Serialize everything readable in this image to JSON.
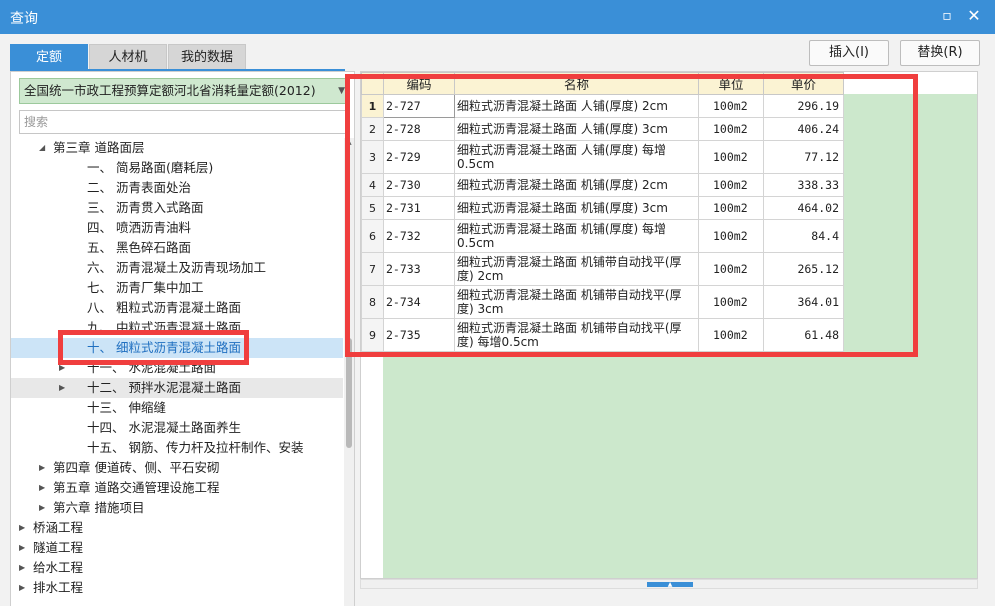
{
  "window": {
    "title": "查询",
    "maximize_glyph": "▫",
    "close_glyph": "✕"
  },
  "tabs": [
    {
      "label": "定额",
      "active": true
    },
    {
      "label": "人材机",
      "active": false
    },
    {
      "label": "我的数据",
      "active": false
    }
  ],
  "actions": {
    "insert_label": "插入(I)",
    "replace_label": "替换(R)"
  },
  "left": {
    "quota_library": "全国统一市政工程预算定额河北省消耗量定额(2012)",
    "search_placeholder": "搜索",
    "tree": [
      {
        "label": "第三章 道路面层",
        "toggle": "◢",
        "level": 1
      },
      {
        "label": "一、 简易路面(磨耗层)",
        "toggle": "",
        "level": 2
      },
      {
        "label": "二、 沥青表面处治",
        "toggle": "",
        "level": 2
      },
      {
        "label": "三、 沥青贯入式路面",
        "toggle": "",
        "level": 2
      },
      {
        "label": "四、 喷洒沥青油料",
        "toggle": "",
        "level": 2
      },
      {
        "label": "五、 黑色碎石路面",
        "toggle": "",
        "level": 2
      },
      {
        "label": "六、 沥青混凝土及沥青现场加工",
        "toggle": "",
        "level": 2
      },
      {
        "label": "七、 沥青厂集中加工",
        "toggle": "",
        "level": 2
      },
      {
        "label": "八、 粗粒式沥青混凝土路面",
        "toggle": "",
        "level": 2
      },
      {
        "label": "九、 中粒式沥青混凝土路面",
        "toggle": "",
        "level": 2
      },
      {
        "label": "十、 细粒式沥青混凝土路面",
        "toggle": "",
        "level": 2,
        "state": "selected"
      },
      {
        "label": "十一、 水泥混凝土路面",
        "toggle": "▶",
        "level": 2
      },
      {
        "label": "十二、 预拌水泥混凝土路面",
        "toggle": "▶",
        "level": 2,
        "state": "hover"
      },
      {
        "label": "十三、 伸缩缝",
        "toggle": "",
        "level": 2
      },
      {
        "label": "十四、 水泥混凝土路面养生",
        "toggle": "",
        "level": 2
      },
      {
        "label": "十五、 钢筋、传力杆及拉杆制作、安装",
        "toggle": "",
        "level": 2
      },
      {
        "label": "第四章 便道砖、侧、平石安砌",
        "toggle": "▶",
        "level": 1
      },
      {
        "label": "第五章 道路交通管理设施工程",
        "toggle": "▶",
        "level": 1
      },
      {
        "label": "第六章 措施项目",
        "toggle": "▶",
        "level": 1
      },
      {
        "label": "桥涵工程",
        "toggle": "▶",
        "level": 0
      },
      {
        "label": "隧道工程",
        "toggle": "▶",
        "level": 0
      },
      {
        "label": "给水工程",
        "toggle": "▶",
        "level": 0
      },
      {
        "label": "排水工程",
        "toggle": "▶",
        "level": 0
      }
    ]
  },
  "grid": {
    "columns": [
      "编码",
      "名称",
      "单位",
      "单价"
    ],
    "rows": [
      {
        "no": "1",
        "code": "2-727",
        "name": "细粒式沥青混凝土路面 人铺(厚度) 2cm",
        "unit": "100m2",
        "price": "296.19"
      },
      {
        "no": "2",
        "code": "2-728",
        "name": "细粒式沥青混凝土路面 人铺(厚度) 3cm",
        "unit": "100m2",
        "price": "406.24"
      },
      {
        "no": "3",
        "code": "2-729",
        "name": "细粒式沥青混凝土路面 人铺(厚度) 每增0.5cm",
        "unit": "100m2",
        "price": "77.12"
      },
      {
        "no": "4",
        "code": "2-730",
        "name": "细粒式沥青混凝土路面 机铺(厚度) 2cm",
        "unit": "100m2",
        "price": "338.33"
      },
      {
        "no": "5",
        "code": "2-731",
        "name": "细粒式沥青混凝土路面 机铺(厚度) 3cm",
        "unit": "100m2",
        "price": "464.02"
      },
      {
        "no": "6",
        "code": "2-732",
        "name": "细粒式沥青混凝土路面 机铺(厚度) 每增0.5cm",
        "unit": "100m2",
        "price": "84.4"
      },
      {
        "no": "7",
        "code": "2-733",
        "name": "细粒式沥青混凝土路面 机铺带自动找平(厚度) 2cm",
        "unit": "100m2",
        "price": "265.12"
      },
      {
        "no": "8",
        "code": "2-734",
        "name": "细粒式沥青混凝土路面 机铺带自动找平(厚度) 3cm",
        "unit": "100m2",
        "price": "364.01"
      },
      {
        "no": "9",
        "code": "2-735",
        "name": "细粒式沥青混凝土路面 机铺带自动找平(厚度) 每增0.5cm",
        "unit": "100m2",
        "price": "61.48"
      }
    ]
  },
  "colors": {
    "accent": "#3a8fd7",
    "highlight": "#f03e3e",
    "grid_bg": "#cce8cc"
  }
}
